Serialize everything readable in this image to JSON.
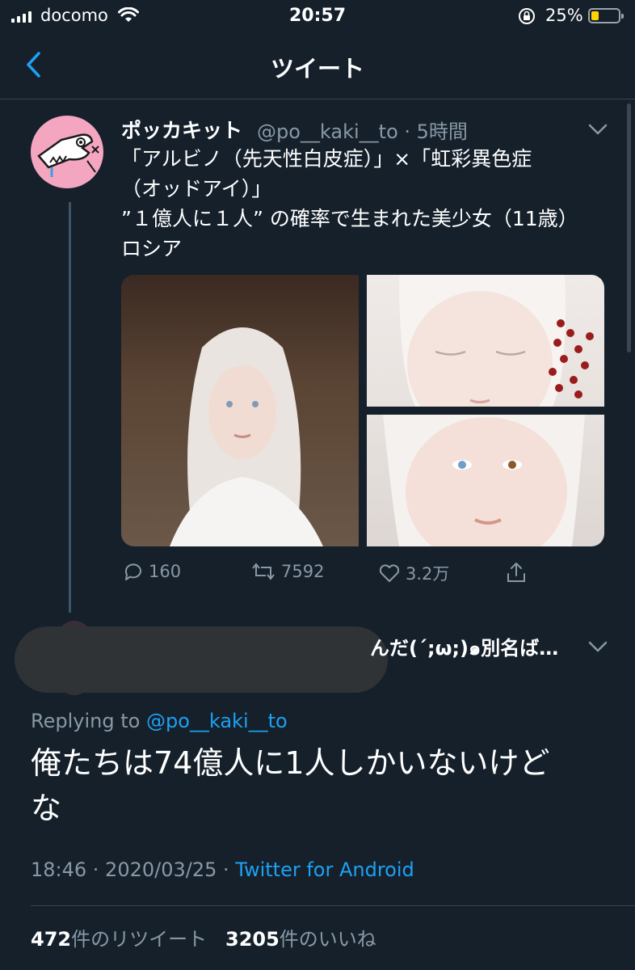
{
  "status_bar": {
    "carrier": "docomo",
    "time": "20:57",
    "battery_percent": "25%",
    "battery_level": 0.25,
    "icons": [
      "signal-icon",
      "wifi-icon",
      "orientation-lock-icon",
      "battery-icon"
    ]
  },
  "header": {
    "title": "ツイート",
    "back_icon": "chevron-left-icon"
  },
  "tweet": {
    "display_name": "ポッカキット",
    "handle_time": "@po__kaki__to · 5時間",
    "text_lines": [
      "「アルビノ（先天性白皮症）」×「虹彩異色症",
      "（オッドアイ）」",
      "”１億人に１人” の確率で生まれた美少女（11歳）",
      "ロシア"
    ],
    "actions": {
      "replies": "160",
      "retweets": "7592",
      "likes": "3.2万"
    }
  },
  "reply": {
    "name_fragment": "んだ(´;ω;)๑別名ば…",
    "replying_prefix": "Replying to",
    "replying_handle": "@po__kaki__to",
    "text_lines": [
      "俺たちは74億人に1人しかいないけど",
      "な"
    ],
    "timestamp": "18:46 · 2020/03/25 · ",
    "source": "Twitter for Android",
    "retweet_count": "472",
    "retweet_label": "件のリツイート",
    "like_count": "3205",
    "like_label": "件のいいね"
  },
  "colors": {
    "background": "#15202b",
    "accent": "#1da1f2",
    "secondary_text": "#8899a6",
    "divider": "#38444d"
  }
}
